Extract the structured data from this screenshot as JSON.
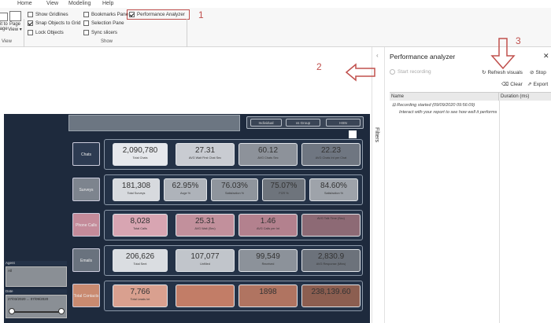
{
  "ribbon": {
    "tabs": [
      "Home",
      "View",
      "Modeling",
      "Help"
    ],
    "fit_label": "Fit to\npage",
    "page_view_label": "Page\nView ▾",
    "view_group_label": "View",
    "show_group_label": "Show",
    "checks": [
      {
        "label": "Show Gridlines",
        "checked": false
      },
      {
        "label": "Snap Objects to Grid",
        "checked": true
      },
      {
        "label": "Lock Objects",
        "checked": false
      },
      {
        "label": "Bookmarks Pane",
        "checked": false
      },
      {
        "label": "Selection Pane",
        "checked": false
      },
      {
        "label": "Sync slicers",
        "checked": false
      },
      {
        "label": "Performance Analyzer",
        "checked": true
      }
    ]
  },
  "annotations": [
    "1",
    "2",
    "3"
  ],
  "filters": {
    "label": "Filters"
  },
  "perf": {
    "title": "Performance analyzer",
    "start_recording": "Start recording",
    "refresh_visuals": "Refresh visuals",
    "stop": "Stop",
    "clear": "Clear",
    "export": "Export",
    "col_name": "Name",
    "col_duration": "Duration (ms)",
    "log_1": "Recording started (09/09/2020 09:56:09)",
    "log_2": "Interact with your report to see how well it performs"
  },
  "report": {
    "toggles": [
      "Individual",
      "vs Group",
      "HSN"
    ],
    "rows": [
      {
        "label": "Chats",
        "color": "#2d3b52",
        "cards": [
          {
            "value": "2,090,780",
            "label": "Total Chats",
            "bg": "#e6e8ec"
          },
          {
            "value": "27.31",
            "label": "AVG Wait First Chat Sec",
            "bg": "#c9ccd2"
          },
          {
            "value": "60.12",
            "label": "AVG Chats Sec",
            "bg": "#8d929a"
          },
          {
            "value": "22.23",
            "label": "AVG Chats Int per Chat",
            "bg": "#6f7681"
          }
        ]
      },
      {
        "label": "Surveys",
        "color": "#7d848e",
        "cards": [
          {
            "value": "181,308",
            "label": "Total Surveys",
            "bg": "#d7dade"
          },
          {
            "value": "62.95%",
            "label": "Avge %",
            "bg": "#aeb3ba"
          },
          {
            "value": "76.03%",
            "label": "Satisfaction %",
            "bg": "#8f959d"
          },
          {
            "value": "75.07%",
            "label": "FCR %",
            "bg": "#6e747c"
          },
          {
            "value": "84.60%",
            "label": "Satisfaction %",
            "bg": "#9ea3aa"
          }
        ]
      },
      {
        "label": "Phone Calls",
        "color": "#c48b9a",
        "cards": [
          {
            "value": "8,028",
            "label": "Total Calls",
            "bg": "#d8a5b2"
          },
          {
            "value": "25.31",
            "label": "AVG Wait (Sec)",
            "bg": "#c2909c"
          },
          {
            "value": "1.46",
            "label": "AVG Calls per Int",
            "bg": "#b3818e"
          },
          {
            "value": "",
            "label": "AVG Talk Time (Sec)",
            "bg": "#8d6a75"
          }
        ]
      },
      {
        "label": "Emails",
        "color": "#69727e",
        "cards": [
          {
            "value": "206,626",
            "label": "Total Sent",
            "bg": "#dadde1"
          },
          {
            "value": "107,077",
            "label": "Unfilled",
            "bg": "#c1c5cb"
          },
          {
            "value": "99,549",
            "label": "Received",
            "bg": "#8c929a"
          },
          {
            "value": "2,830.9",
            "label": "AVG Response (Mins)",
            "bg": "#6c727b"
          }
        ]
      },
      {
        "label": "Total Contacts",
        "color": "#c98a70",
        "cards": [
          {
            "value": "7,766",
            "label": "Total Leads Int",
            "bg": "#d9a08f"
          },
          {
            "value": "",
            "label": "",
            "bg": "#c27d67"
          },
          {
            "value": "1898",
            "label": "",
            "bg": "#b07461"
          },
          {
            "value": "238,139.60",
            "label": "",
            "bg": "#8c5e50"
          }
        ]
      }
    ],
    "slicer_agent_title": "Agent",
    "slicer_agent_value": "All",
    "slicer_date_title": "Date",
    "slicer_date_value": "27/03/2020 ... 07/09/2020"
  }
}
